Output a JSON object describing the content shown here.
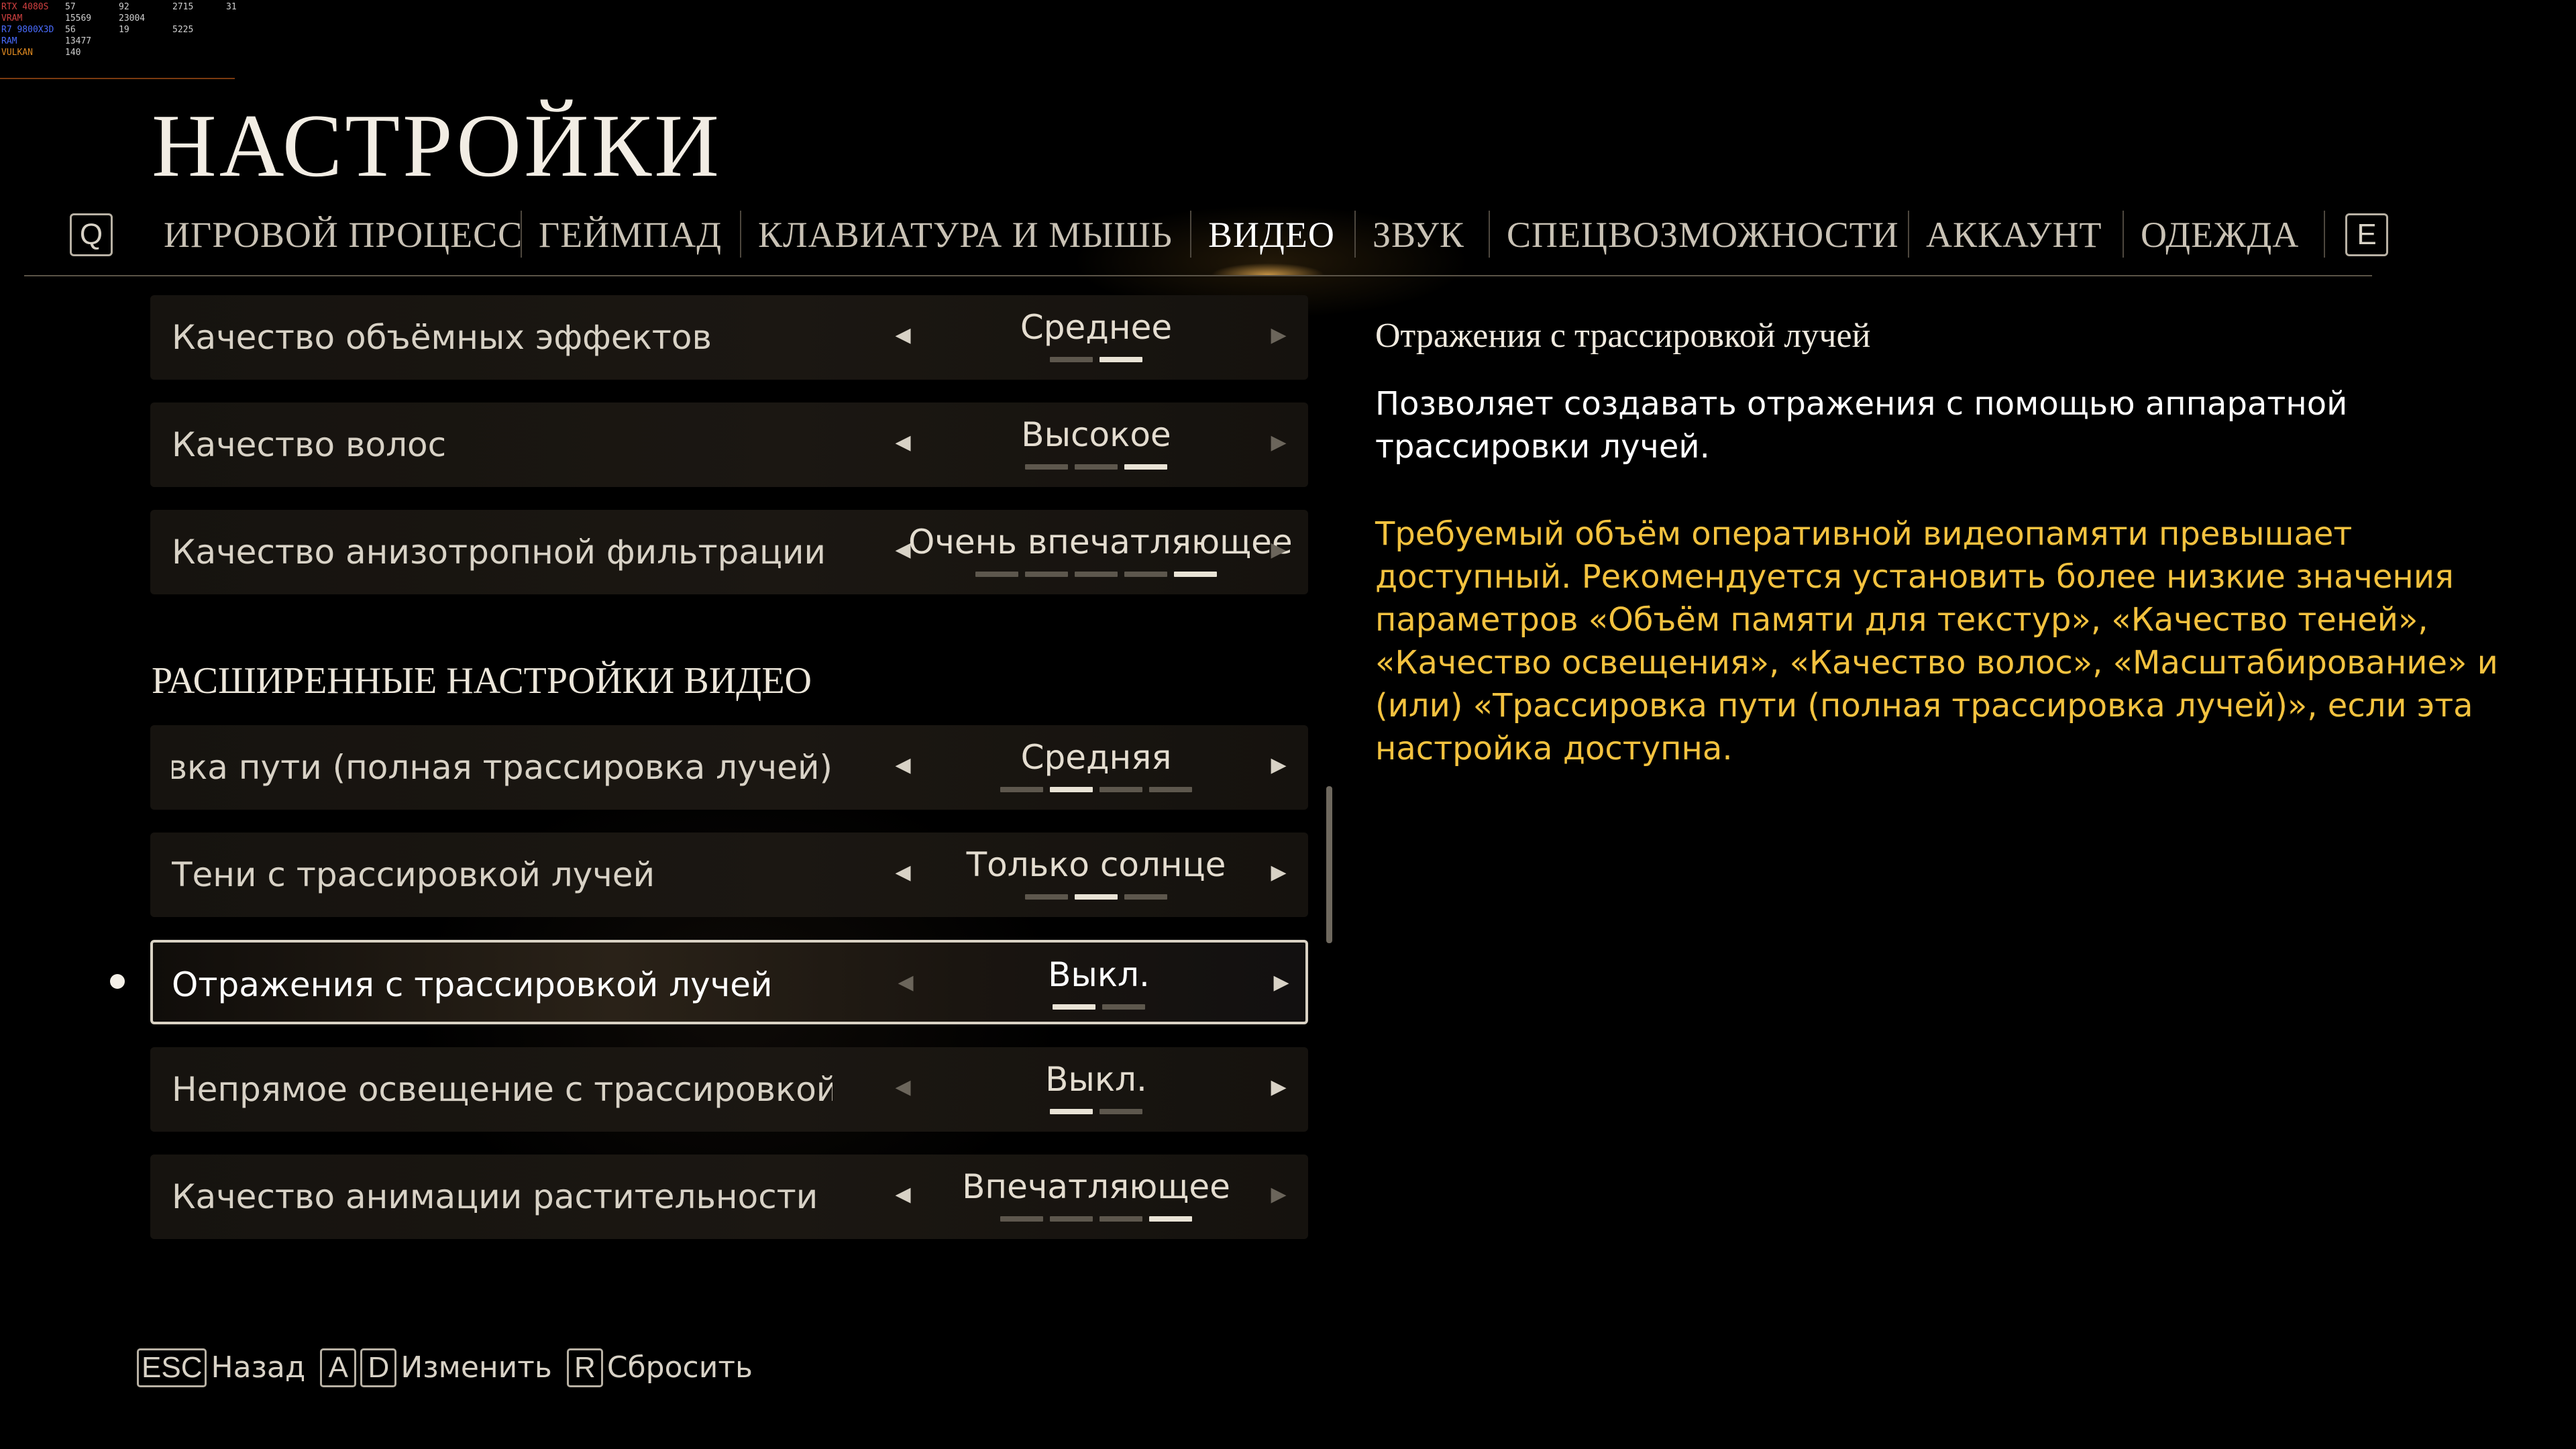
{
  "osd": {
    "rows": [
      {
        "label": "RTX 4080S",
        "label_color": "#d04040",
        "v1": "57",
        "v2": "92",
        "v3": "2715",
        "v4": "31"
      },
      {
        "label": "VRAM",
        "label_color": "#d04040",
        "v1": "15569",
        "v2": "23004",
        "v3": "",
        "v4": ""
      },
      {
        "label": "R7 9800X3D",
        "label_color": "#4a6cff",
        "v1": "56",
        "v2": "19",
        "v3": "5225",
        "v4": ""
      },
      {
        "label": "RAM",
        "label_color": "#4a6cff",
        "v1": "13477",
        "v2": "",
        "v3": "",
        "v4": ""
      },
      {
        "label": "VULKAN",
        "label_color": "#e08a20",
        "v1": "140",
        "v2": "",
        "v3": "",
        "v4": ""
      }
    ]
  },
  "page": {
    "title": "НАСТРОЙКИ"
  },
  "tabs": {
    "prev_key": "Q",
    "next_key": "E",
    "items": [
      {
        "label": "ИГРОВОЙ ПРОЦЕСС",
        "active": false
      },
      {
        "label": "ГЕЙМПАД",
        "active": false
      },
      {
        "label": "КЛАВИАТУРА И МЫШЬ",
        "active": false
      },
      {
        "label": "ВИДЕО",
        "active": true
      },
      {
        "label": "ЗВУК",
        "active": false
      },
      {
        "label": "СПЕЦВОЗМОЖНОСТИ",
        "active": false
      },
      {
        "label": "АККАУНТ",
        "active": false
      },
      {
        "label": "ОДЕЖДА",
        "active": false
      }
    ]
  },
  "settings": {
    "rows_top": [
      {
        "label": "Качество объёмных эффектов",
        "value": "Среднее",
        "level": 2,
        "levels": 2,
        "left_dim": false,
        "right_dim": true
      },
      {
        "label": "Качество волос",
        "value": "Высокое",
        "level": 3,
        "levels": 3,
        "left_dim": false,
        "right_dim": true
      },
      {
        "label": "Качество анизотропной фильтрации",
        "value": "Очень впечатляющее",
        "level": 5,
        "levels": 5,
        "left_dim": false,
        "right_dim": true
      }
    ],
    "section_header": "РАСШИРЕННЫЕ НАСТРОЙКИ ВИДЕО",
    "rows_advanced": [
      {
        "label": "Трассировка пути (полная трассировка лучей)",
        "value": "Средняя",
        "level": 2,
        "levels": 4,
        "left_dim": false,
        "right_dim": false
      },
      {
        "label": "Тени с трассировкой лучей",
        "value": "Только солнце",
        "level": 2,
        "levels": 3,
        "left_dim": false,
        "right_dim": false
      },
      {
        "label": "Отражения с трассировкой лучей",
        "value": "Выкл.",
        "level": 1,
        "levels": 2,
        "left_dim": true,
        "right_dim": false,
        "selected": true
      },
      {
        "label": "Непрямое освещение с трассировкой лучей",
        "value": "Выкл.",
        "level": 1,
        "levels": 2,
        "left_dim": true,
        "right_dim": false
      },
      {
        "label": "Качество анимации растительности",
        "value": "Впечатляющее",
        "level": 4,
        "levels": 4,
        "left_dim": false,
        "right_dim": true
      }
    ]
  },
  "description": {
    "title": "Отражения с трассировкой лучей",
    "body": "Позволяет создавать отражения с помощью аппаратной трассировки лучей.",
    "warning": "Требуемый объём оперативной видеопамяти превышает доступный. Рекомендуется установить более низкие значения параметров «Объём памяти для текстур», «Качество теней», «Качество освещения», «Качество волос», «Масштабирование» и (или) «Трассировка пути (полная трассировка лучей)», если эта настройка доступна."
  },
  "hints": {
    "back_key": "ESC",
    "back_label": "Назад",
    "change_key_left": "A",
    "change_key_right": "D",
    "change_label": "Изменить",
    "reset_key": "R",
    "reset_label": "Сбросить"
  }
}
